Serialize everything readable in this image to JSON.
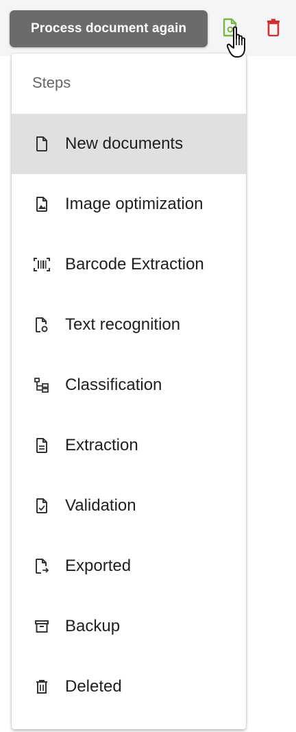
{
  "toolbar": {
    "tooltip": "Process document again",
    "actions": [
      {
        "name": "process-again",
        "icon": "file-refresh-icon",
        "color": "#7cb342"
      },
      {
        "name": "delete",
        "icon": "trash-icon",
        "color": "#d32f2f"
      }
    ]
  },
  "menu": {
    "header": "Steps",
    "selected_index": 0,
    "items": [
      {
        "label": "New documents",
        "icon": "file-outline-icon"
      },
      {
        "label": "Image optimization",
        "icon": "file-image-icon"
      },
      {
        "label": "Barcode Extraction",
        "icon": "barcode-scan-icon"
      },
      {
        "label": "Text recognition",
        "icon": "file-eye-icon"
      },
      {
        "label": "Classification",
        "icon": "file-tree-icon"
      },
      {
        "label": "Extraction",
        "icon": "file-document-icon"
      },
      {
        "label": "Validation",
        "icon": "file-check-icon"
      },
      {
        "label": "Exported",
        "icon": "file-export-icon"
      },
      {
        "label": "Backup",
        "icon": "archive-icon"
      },
      {
        "label": "Deleted",
        "icon": "trash-outline-icon"
      }
    ]
  },
  "colors": {
    "tooltip_bg": "#6b6b6b",
    "selected_bg": "#e0e0e0",
    "process_green": "#7cb342",
    "delete_red": "#d32f2f"
  }
}
